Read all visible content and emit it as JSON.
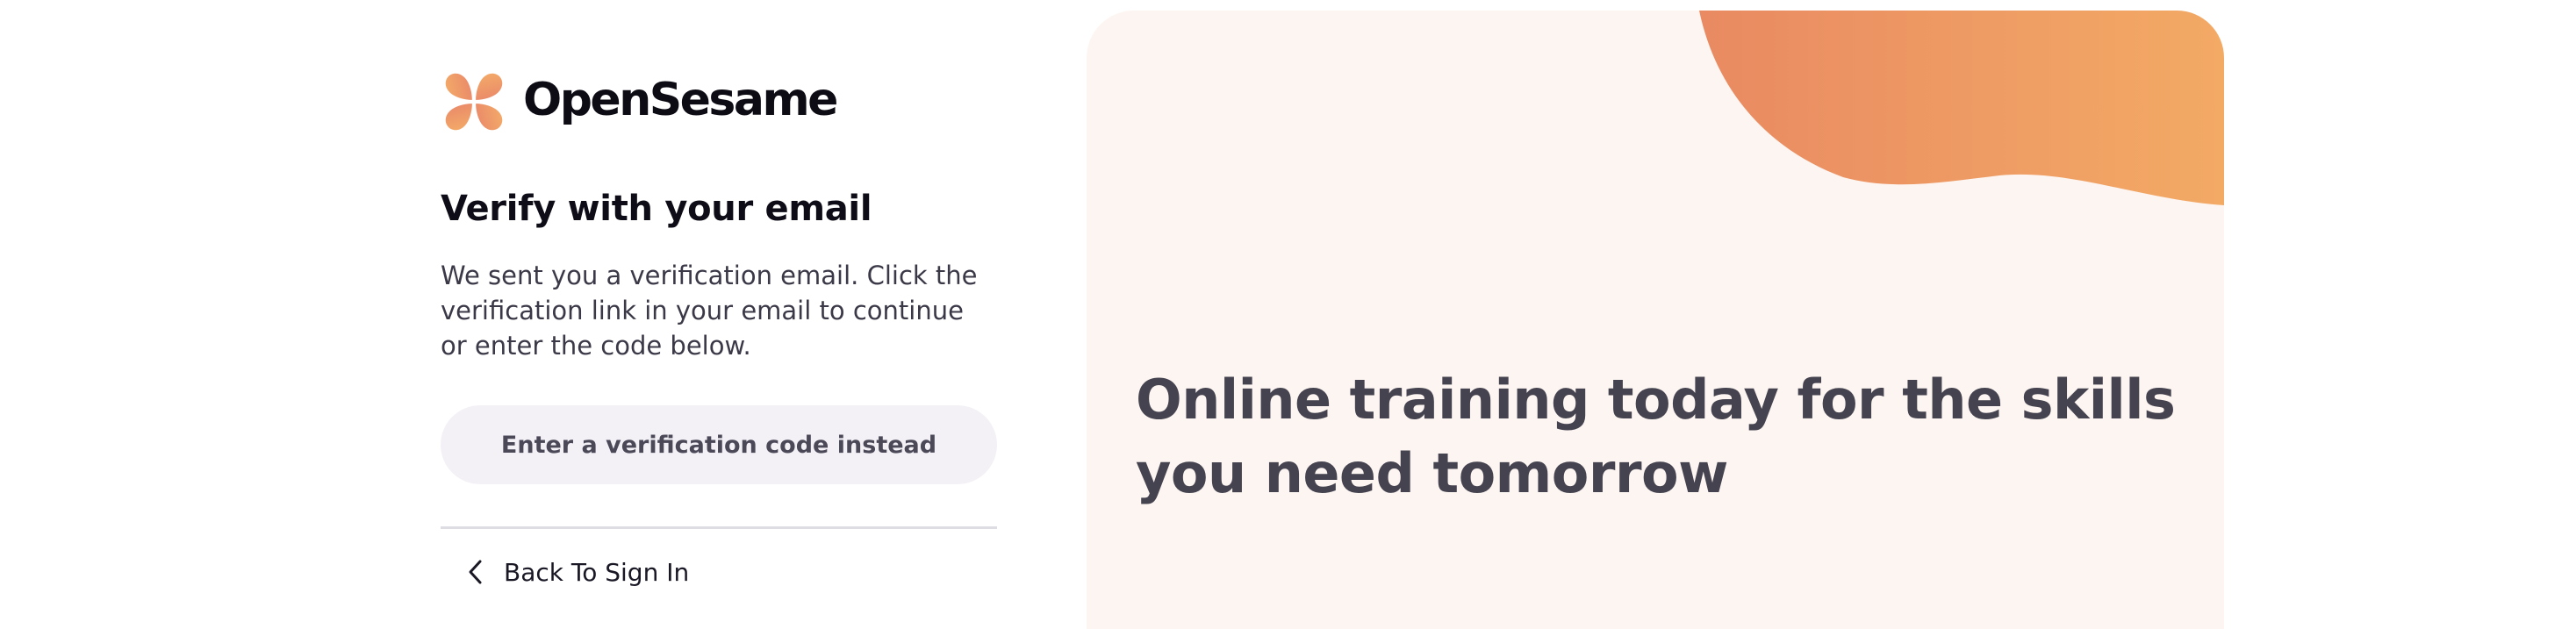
{
  "brand": {
    "name": "OpenSesame",
    "logo_icon": "four-petal-logo-icon",
    "accent_light": "#f2a866",
    "accent_dark": "#e8836a"
  },
  "verify": {
    "heading": "Verify with your email",
    "description": "We sent you a verification email. Click the verification link in your email to continue or enter the code below.",
    "code_button_label": "Enter a verification code instead",
    "back_icon": "chevron-left-icon",
    "back_label": "Back To Sign In"
  },
  "promo": {
    "tagline": "Online training today for the skills you need tomorrow",
    "background": "#fdf5f1",
    "text_color": "#45434f"
  }
}
